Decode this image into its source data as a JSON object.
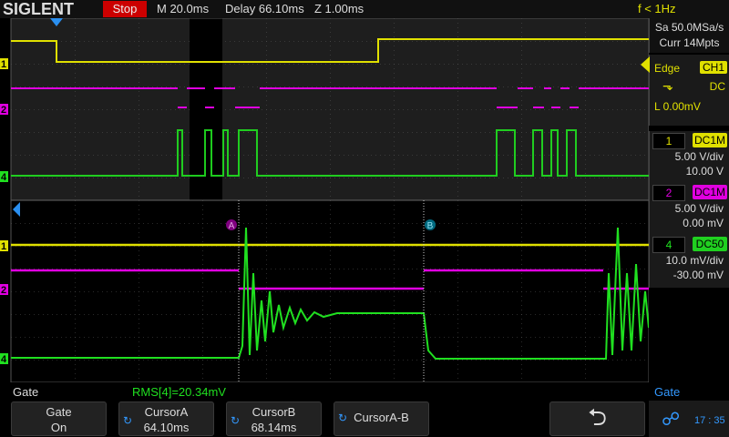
{
  "header": {
    "logo": "SIGLENT",
    "run_state": "Stop",
    "timebase": "M 20.0ms",
    "delay": "Delay 66.10ms",
    "zoom": "Z 1.00ms",
    "trigger_freq": "f < 1Hz"
  },
  "acquisition": {
    "sample_rate": "Sa 50.0MSa/s",
    "memory": "Curr 14Mpts"
  },
  "trigger": {
    "type": "Edge",
    "source": "CH1",
    "coupling": "DC",
    "level": "L  0.00mV",
    "slope_icon": "falling-edge-icon"
  },
  "channels": [
    {
      "num": "1",
      "coupling": "DC1M",
      "scale": "5.00 V/div",
      "offset": "10.00 V",
      "color": "#e0e000"
    },
    {
      "num": "2",
      "coupling": "DC1M",
      "scale": "5.00 V/div",
      "offset": "0.00 mV",
      "color": "#e000e0"
    },
    {
      "num": "4",
      "coupling": "DC50",
      "scale": "10.0 mV/div",
      "offset": "-30.00 mV",
      "color": "#20e020"
    }
  ],
  "markers": {
    "ch1": "1",
    "ch2": "2",
    "ch4": "4",
    "cursor_a": "A",
    "cursor_b": "B"
  },
  "status": {
    "left": "Gate",
    "measurement": "RMS[4]=20.34mV",
    "right": "Gate"
  },
  "softkeys": [
    {
      "line1": "Gate",
      "line2": "On"
    },
    {
      "line1": "CursorA",
      "line2": "64.10ms"
    },
    {
      "line1": "CursorB",
      "line2": "68.14ms"
    },
    {
      "line1": "CursorA-B",
      "line2": ""
    }
  ],
  "clock": "17 : 35"
}
